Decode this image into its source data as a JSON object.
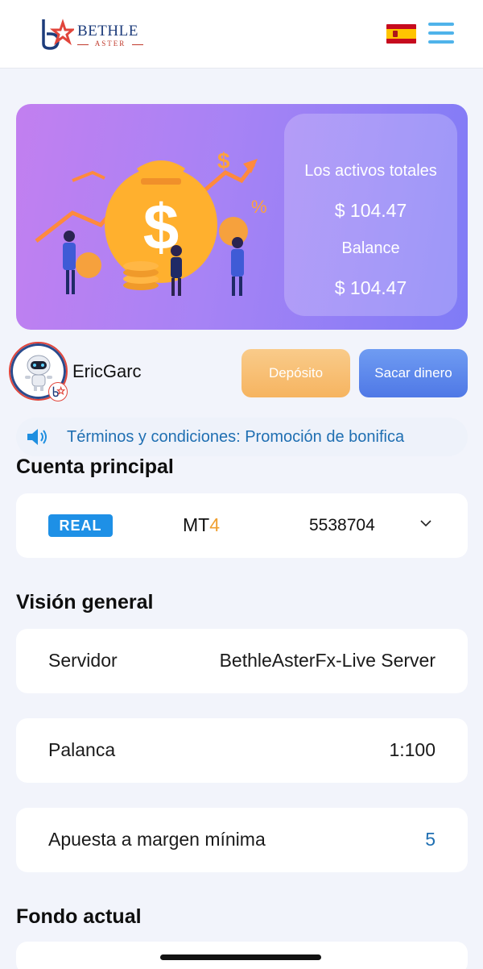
{
  "header": {
    "logo_title": "BETHLE",
    "logo_subtitle": "ASTER",
    "language_flag": "spain-flag-icon",
    "menu_icon": "hamburger-menu-icon"
  },
  "banner": {
    "total_assets_label": "Los activos totales",
    "total_assets_value": "$ 104.47",
    "balance_label": "Balance",
    "balance_value": "$ 104.47"
  },
  "user": {
    "name": "EricGarc",
    "deposit_label": "Depósito",
    "withdraw_label": "Sacar dinero"
  },
  "notice": {
    "text": "Términos y condiciones: Promoción de bonifica"
  },
  "main_account": {
    "title": "Cuenta principal",
    "type_badge": "REAL",
    "platform_prefix": "MT",
    "platform_version": "4",
    "account_number": "5538704"
  },
  "overview": {
    "title": "Visión general",
    "rows": [
      {
        "label": "Servidor",
        "value": "BethleAsterFx-Live Server"
      },
      {
        "label": "Palanca",
        "value": "1:100"
      },
      {
        "label": "Apuesta a margen mínima",
        "value": "5"
      }
    ]
  },
  "current_fund": {
    "title": "Fondo actual"
  },
  "colors": {
    "accent_blue": "#1f6fb2",
    "deposit_orange": "#f6b460",
    "withdraw_blue": "#4f78e6",
    "real_badge": "#1e90e6",
    "banner_purple": "#a783f5"
  }
}
